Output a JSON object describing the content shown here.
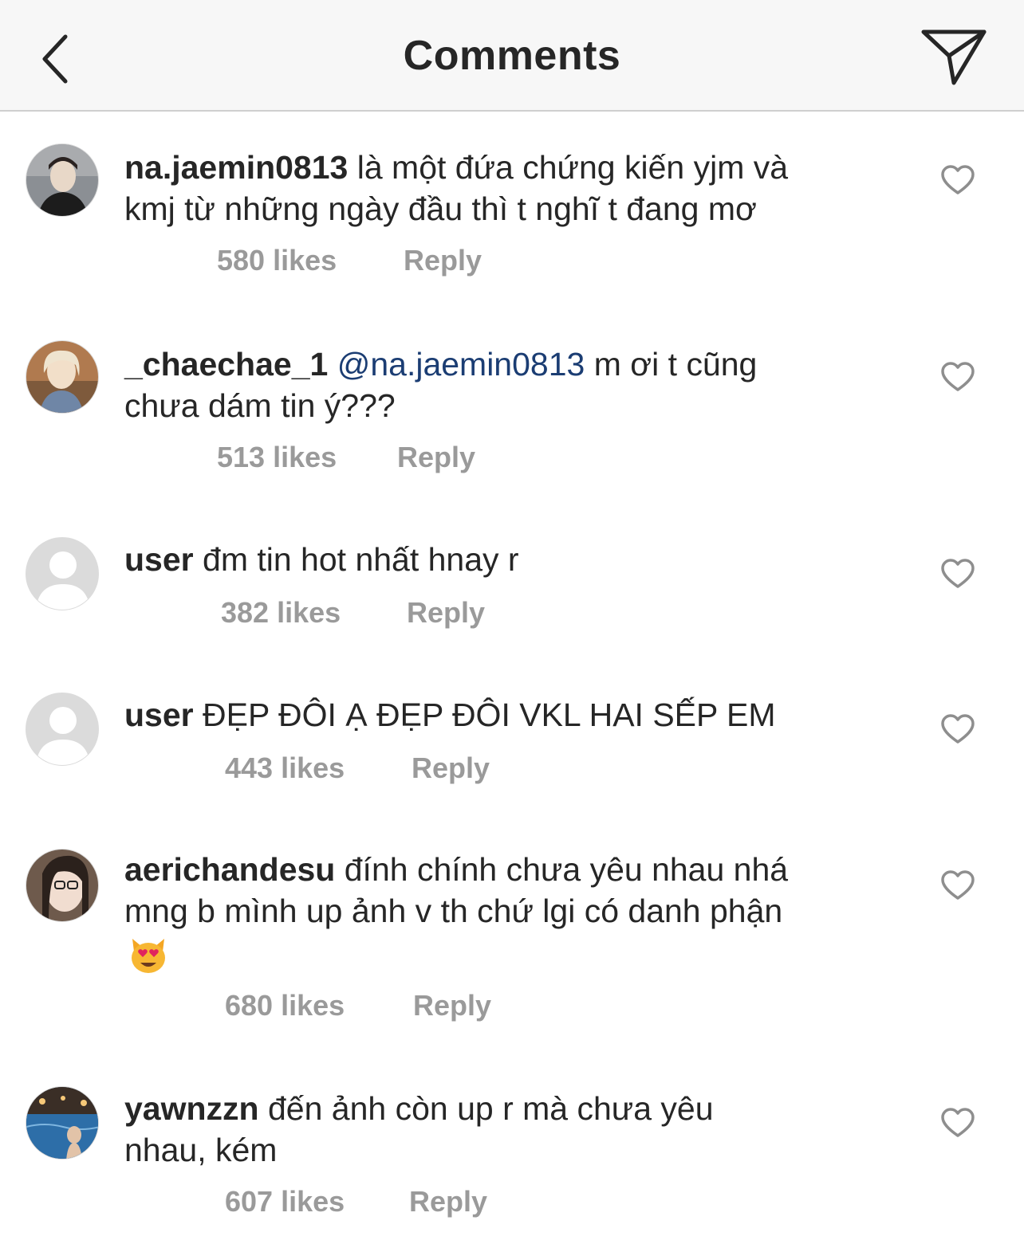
{
  "header": {
    "title": "Comments",
    "back_icon": "chevron-left-icon",
    "send_icon": "paper-plane-icon"
  },
  "colors": {
    "header_bg": "#f7f7f7",
    "text": "#262626",
    "meta": "#9a9a9a",
    "mention": "#1b3d73"
  },
  "comments": [
    {
      "username": "na.jaemin0813",
      "text_line1": "là một đứa chứng kiến yjm và",
      "text_line2": "kmj từ những ngày đầu thì t nghĩ t đang mơ",
      "likes": "580 likes",
      "reply": "Reply"
    },
    {
      "username": "_chaechae_1",
      "mention": "@na.jaemin0813",
      "text_line1": "m ơi t cũng",
      "text_line2": "chưa dám tin ý???",
      "likes": "513 likes",
      "reply": "Reply"
    },
    {
      "username": "user",
      "text_line1": "đm tin hot nhất hnay r",
      "likes": "382 likes",
      "reply": "Reply"
    },
    {
      "username": "user",
      "text_line1": "ĐẸP ĐÔI Ạ ĐẸP ĐÔI VKL HAI SẾP EM",
      "likes": "443 likes",
      "reply": "Reply"
    },
    {
      "username": "aerichandesu",
      "text_line1": "đính chính chưa yêu nhau nhá",
      "text_line2": "mng b mình up ảnh v th chứ lgi có danh phận",
      "emoji": "heart-eyes-cat-emoji",
      "likes": "680 likes",
      "reply": "Reply"
    },
    {
      "username": "yawnzzn",
      "text_line1": "đến ảnh còn up r mà chưa yêu",
      "text_line2": "nhau, kém",
      "likes": "607 likes",
      "reply": "Reply"
    }
  ]
}
